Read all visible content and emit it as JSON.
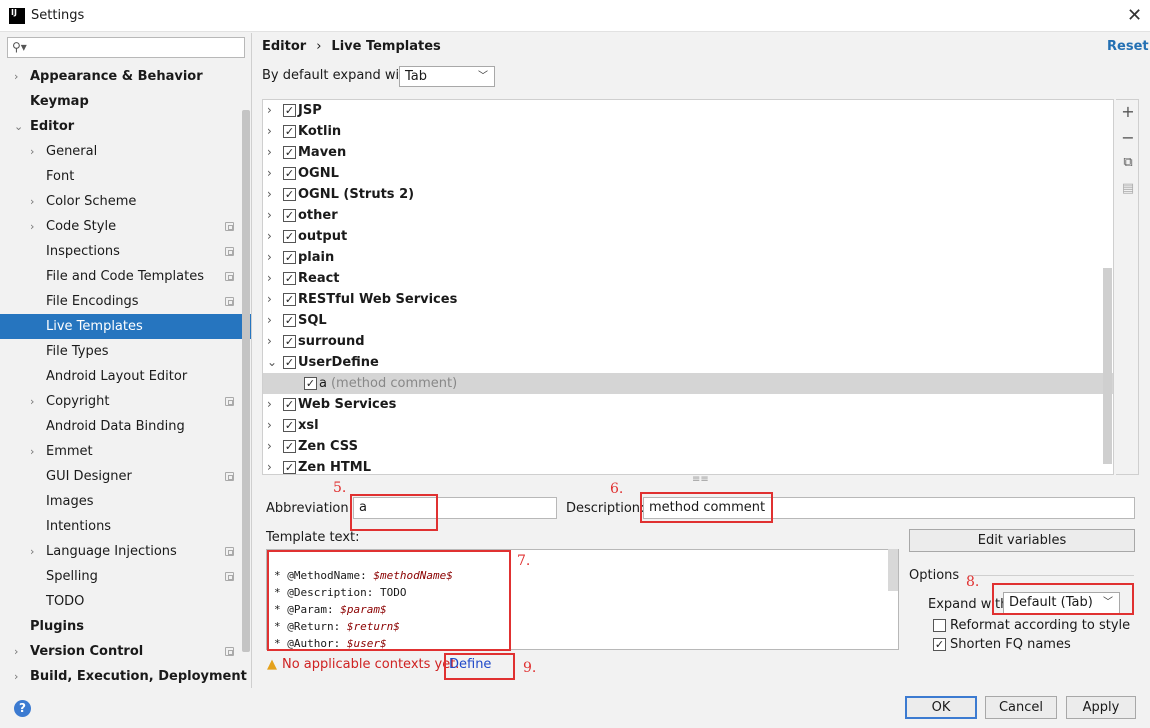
{
  "window": {
    "title": "Settings",
    "app_icon_text": "IJ"
  },
  "sidebar": {
    "search_placeholder": "",
    "items": [
      {
        "label": "Appearance & Behavior",
        "bold": true,
        "chevron": true
      },
      {
        "label": "Keymap",
        "bold": true,
        "chevron": false
      },
      {
        "label": "Editor",
        "bold": true,
        "chevron": true,
        "expanded": true
      },
      {
        "label": "General",
        "chevron": true,
        "indent": 1
      },
      {
        "label": "Font",
        "indent": 1
      },
      {
        "label": "Color Scheme",
        "chevron": true,
        "indent": 1
      },
      {
        "label": "Code Style",
        "chevron": true,
        "indent": 1,
        "project_icon": true
      },
      {
        "label": "Inspections",
        "indent": 1,
        "project_icon": true
      },
      {
        "label": "File and Code Templates",
        "indent": 1,
        "project_icon": true
      },
      {
        "label": "File Encodings",
        "indent": 1,
        "project_icon": true
      },
      {
        "label": "Live Templates",
        "indent": 1,
        "selected": true
      },
      {
        "label": "File Types",
        "indent": 1
      },
      {
        "label": "Android Layout Editor",
        "indent": 1
      },
      {
        "label": "Copyright",
        "chevron": true,
        "indent": 1,
        "project_icon": true
      },
      {
        "label": "Android Data Binding",
        "indent": 1
      },
      {
        "label": "Emmet",
        "chevron": true,
        "indent": 1
      },
      {
        "label": "GUI Designer",
        "indent": 1,
        "project_icon": true
      },
      {
        "label": "Images",
        "indent": 1
      },
      {
        "label": "Intentions",
        "indent": 1
      },
      {
        "label": "Language Injections",
        "chevron": true,
        "indent": 1,
        "project_icon": true
      },
      {
        "label": "Spelling",
        "indent": 1,
        "project_icon": true
      },
      {
        "label": "TODO",
        "indent": 1
      },
      {
        "label": "Plugins",
        "bold": true
      },
      {
        "label": "Version Control",
        "bold": true,
        "chevron": true,
        "project_icon": true
      },
      {
        "label": "Build, Execution, Deployment",
        "bold": true,
        "chevron": true
      }
    ]
  },
  "header": {
    "breadcrumb_root": "Editor",
    "breadcrumb_sep": "›",
    "breadcrumb_leaf": "Live Templates",
    "reset": "Reset"
  },
  "expand_default": {
    "label": "By default expand with",
    "value": "Tab"
  },
  "template_groups": [
    {
      "name": "JSP",
      "checked": true
    },
    {
      "name": "Kotlin",
      "checked": true
    },
    {
      "name": "Maven",
      "checked": true
    },
    {
      "name": "OGNL",
      "checked": true
    },
    {
      "name": "OGNL (Struts 2)",
      "checked": true
    },
    {
      "name": "other",
      "checked": true
    },
    {
      "name": "output",
      "checked": true
    },
    {
      "name": "plain",
      "checked": true
    },
    {
      "name": "React",
      "checked": true
    },
    {
      "name": "RESTful Web Services",
      "checked": true
    },
    {
      "name": "SQL",
      "checked": true
    },
    {
      "name": "surround",
      "checked": true
    },
    {
      "name": "UserDefine",
      "checked": true,
      "expanded": true
    },
    {
      "name": "a",
      "desc": "(method comment)",
      "checked": true,
      "child": true
    },
    {
      "name": "Web Services",
      "checked": true
    },
    {
      "name": "xsl",
      "checked": true
    },
    {
      "name": "Zen CSS",
      "checked": true
    },
    {
      "name": "Zen HTML",
      "checked": true
    }
  ],
  "toolbar_icons": [
    "add-icon",
    "remove-icon",
    "copy-icon",
    "group-icon"
  ],
  "editor": {
    "abbreviation_label": "Abbreviation:",
    "abbreviation_value": "a",
    "description_label": "Description:",
    "description_value": "method comment",
    "template_text_label": "Template text:",
    "template_lines": [
      {
        "text": "",
        "var": ""
      },
      {
        "text": "* @MethodName: ",
        "var": "$methodName$"
      },
      {
        "text": "* @Description: TODO",
        "var": ""
      },
      {
        "text": "* @Param: ",
        "var": "$param$"
      },
      {
        "text": "* @Return: ",
        "var": "$return$"
      },
      {
        "text": "* @Author: ",
        "var": "$user$"
      }
    ],
    "edit_variables": "Edit variables",
    "warning": "No applicable contexts yet.",
    "define": "Define"
  },
  "options": {
    "title": "Options",
    "expand_with_label": "Expand with",
    "expand_with_value": "Default (Tab)",
    "reformat_label": "Reformat according to style",
    "reformat_checked": false,
    "shorten_label": "Shorten FQ names",
    "shorten_checked": true
  },
  "annotations": [
    "5.",
    "6.",
    "7.",
    "8.",
    "9."
  ],
  "buttons": {
    "ok": "OK",
    "cancel": "Cancel",
    "apply": "Apply",
    "help": "?"
  },
  "colors": {
    "accent": "#2675bf",
    "annotation_red": "#e03131",
    "link": "#2470b3",
    "selected_row": "#d5d5d5"
  }
}
